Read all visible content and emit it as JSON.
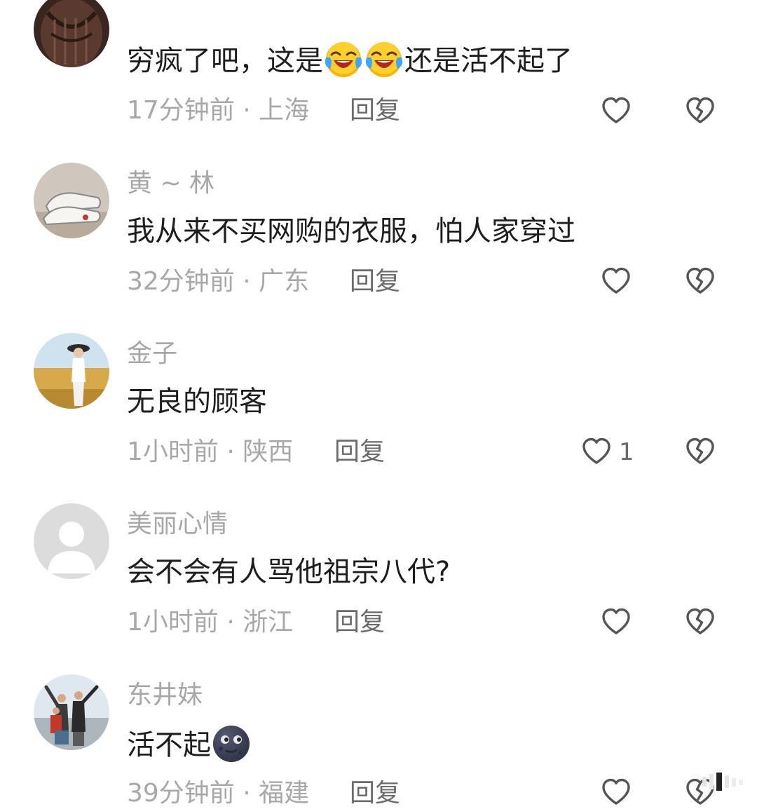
{
  "comments": [
    {
      "username": "",
      "text_parts": [
        "穷疯了吧，这是",
        "还是活不起了"
      ],
      "emoji": "laughing-crying-emoji",
      "time": "17分钟前",
      "location": "上海",
      "reply_label": "回复",
      "likes": ""
    },
    {
      "username": "黄 ~ 林",
      "text": "我从来不买网购的衣服，怕人家穿过",
      "time": "32分钟前",
      "location": "广东",
      "reply_label": "回复",
      "likes": ""
    },
    {
      "username": "金子",
      "text": "无良的顾客",
      "time": "1小时前",
      "location": "陕西",
      "reply_label": "回复",
      "likes": "1"
    },
    {
      "username": "美丽心情",
      "text": "会不会有人骂他祖宗八代?",
      "time": "1小时前",
      "location": "浙江",
      "reply_label": "回复",
      "likes": ""
    },
    {
      "username": "东井妹",
      "text": "活不起",
      "emoji": "dark-moon-face-emoji",
      "time": "39分钟前",
      "location": "福建",
      "reply_label": "回复",
      "likes": ""
    }
  ],
  "meta_separator": " · ",
  "icons": {
    "like": "heart-outline-icon",
    "dislike": "broken-heart-icon"
  },
  "colors": {
    "text": "#1e1e1e",
    "meta": "#a8a8a8",
    "reply": "#6b6b6b",
    "icon": "#555555"
  }
}
